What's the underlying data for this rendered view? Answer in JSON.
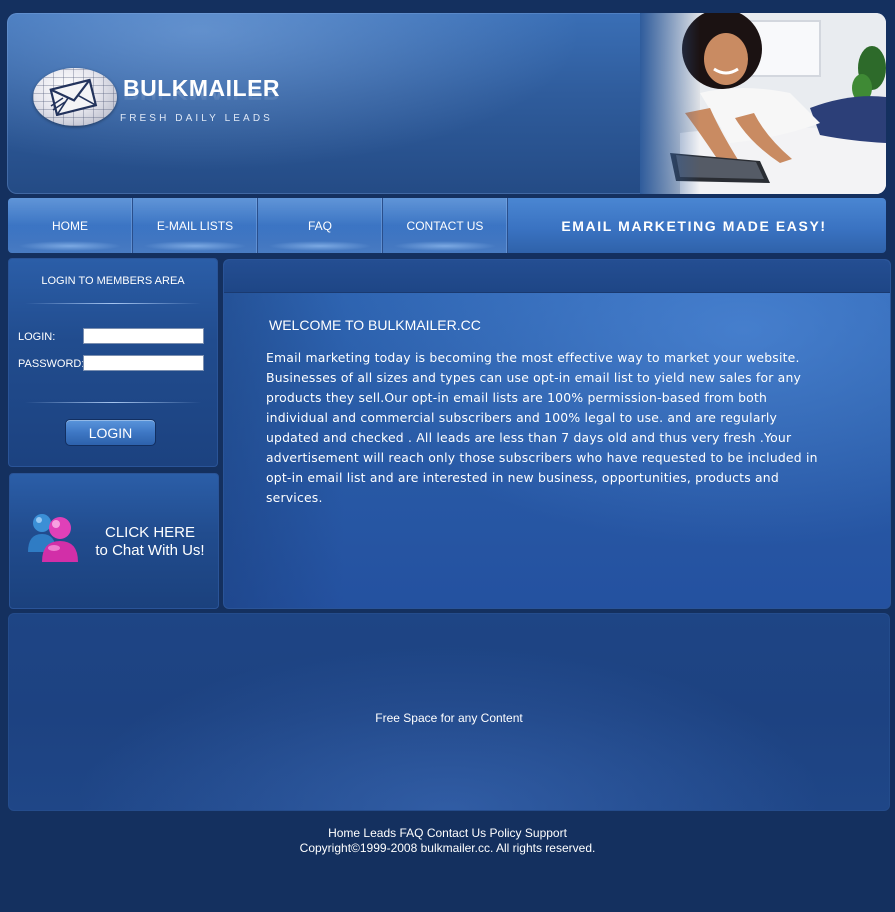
{
  "header": {
    "logo_title": "BULKMAILER",
    "logo_tagline": "FRESH DAILY LEADS",
    "hero_image": "woman-with-laptop-photo"
  },
  "nav": {
    "items": [
      {
        "label": "HOME"
      },
      {
        "label": "E-MAIL LISTS"
      },
      {
        "label": "FAQ"
      },
      {
        "label": "CONTACT US"
      }
    ],
    "slogan": "EMAIL MARKETING MADE EASY!"
  },
  "login": {
    "title": "LOGIN TO MEMBERS AREA",
    "login_label": "LOGIN:",
    "login_value": "",
    "password_label": "PASSWORD:",
    "password_value": "",
    "button_label": "LOGIN"
  },
  "chat": {
    "line1": "CLICK HERE",
    "line2": "to Chat With Us!",
    "icon": "messenger-people-icon"
  },
  "main": {
    "heading": "WELCOME TO BULKMAILER.CC",
    "body": "Email marketing today is becoming the most effective way to market your website. Businesses of all sizes and types can use opt-in email list to yield new sales for any products they sell.Our opt-in email lists are 100% permission-based  from both  individual and commercial subscribers and 100% legal to use. and are regularly updated and checked . All leads are less than 7 days old and thus very fresh .Your advertisement will reach only those subscribers who have requested to be included in opt-in email list and are interested in new business, opportunities, products and services."
  },
  "free_space": {
    "text": "Free Space for any Content"
  },
  "footer": {
    "links": [
      "Home",
      "Leads",
      "FAQ",
      "Contact Us",
      "Policy",
      "Support"
    ],
    "copyright": "Copyright©1999-2008 bulkmailer.cc. All rights reserved."
  },
  "colors": {
    "page_background": "#14305f",
    "panel_blue": "#2a5da8",
    "nav_blue": "#3a73c2",
    "chat_icon_pink": "#e040b8",
    "chat_icon_blue": "#3b8fd6"
  }
}
